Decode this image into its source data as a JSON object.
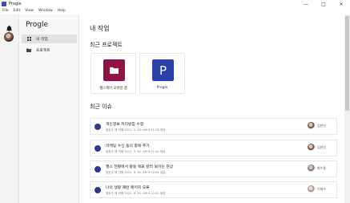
{
  "window": {
    "title": "Progle",
    "minimize_glyph": "—",
    "maximize_glyph": "□",
    "close_glyph": "✕"
  },
  "menu": [
    "File",
    "Edit",
    "View",
    "Window",
    "Help"
  ],
  "sidebar": {
    "brand": "Progle",
    "items": [
      {
        "label": "내 작업",
        "icon": "grid-icon",
        "active": true
      },
      {
        "label": "프로젝트",
        "icon": "folder-icon",
        "active": false
      }
    ]
  },
  "main": {
    "page_title": "내 작업",
    "recent_projects_title": "최근 프로젝트",
    "projects": [
      {
        "name": "헬스케어 모바일 앱",
        "icon": "folder-icon",
        "icon_glyph": "",
        "color": "#8c1545"
      },
      {
        "name": "Progle",
        "icon": "progle-logo-icon",
        "icon_glyph": "P",
        "color": "#2d3fa8"
      }
    ],
    "recent_issues_title": "최근 이슈",
    "issues": [
      {
        "title": "개인정보 처리방침 수정",
        "meta": "정호주 에 의해 2021. 9. 26. AM 9:11:28 생성.",
        "user": "김한신"
      },
      {
        "title": "마케팅 수신 동의 항목 추가",
        "meta": "정호주 에 의해 2021. 9. 30. AM 9:11:40 생성.",
        "user": "김한신"
      },
      {
        "title": "헬스 현황에서 활동 목표 칼러 보이는 현상",
        "meta": "정호주 에 의해 2021. 9. 30. AM 9:12:04 생성.",
        "user": "최수용"
      },
      {
        "title": "나의 생활 패턴 페이지 오류",
        "meta": "정호주 에 의해 2021. 9. 30. AM 9:12:42 생성.",
        "user": "이재수"
      }
    ]
  }
}
